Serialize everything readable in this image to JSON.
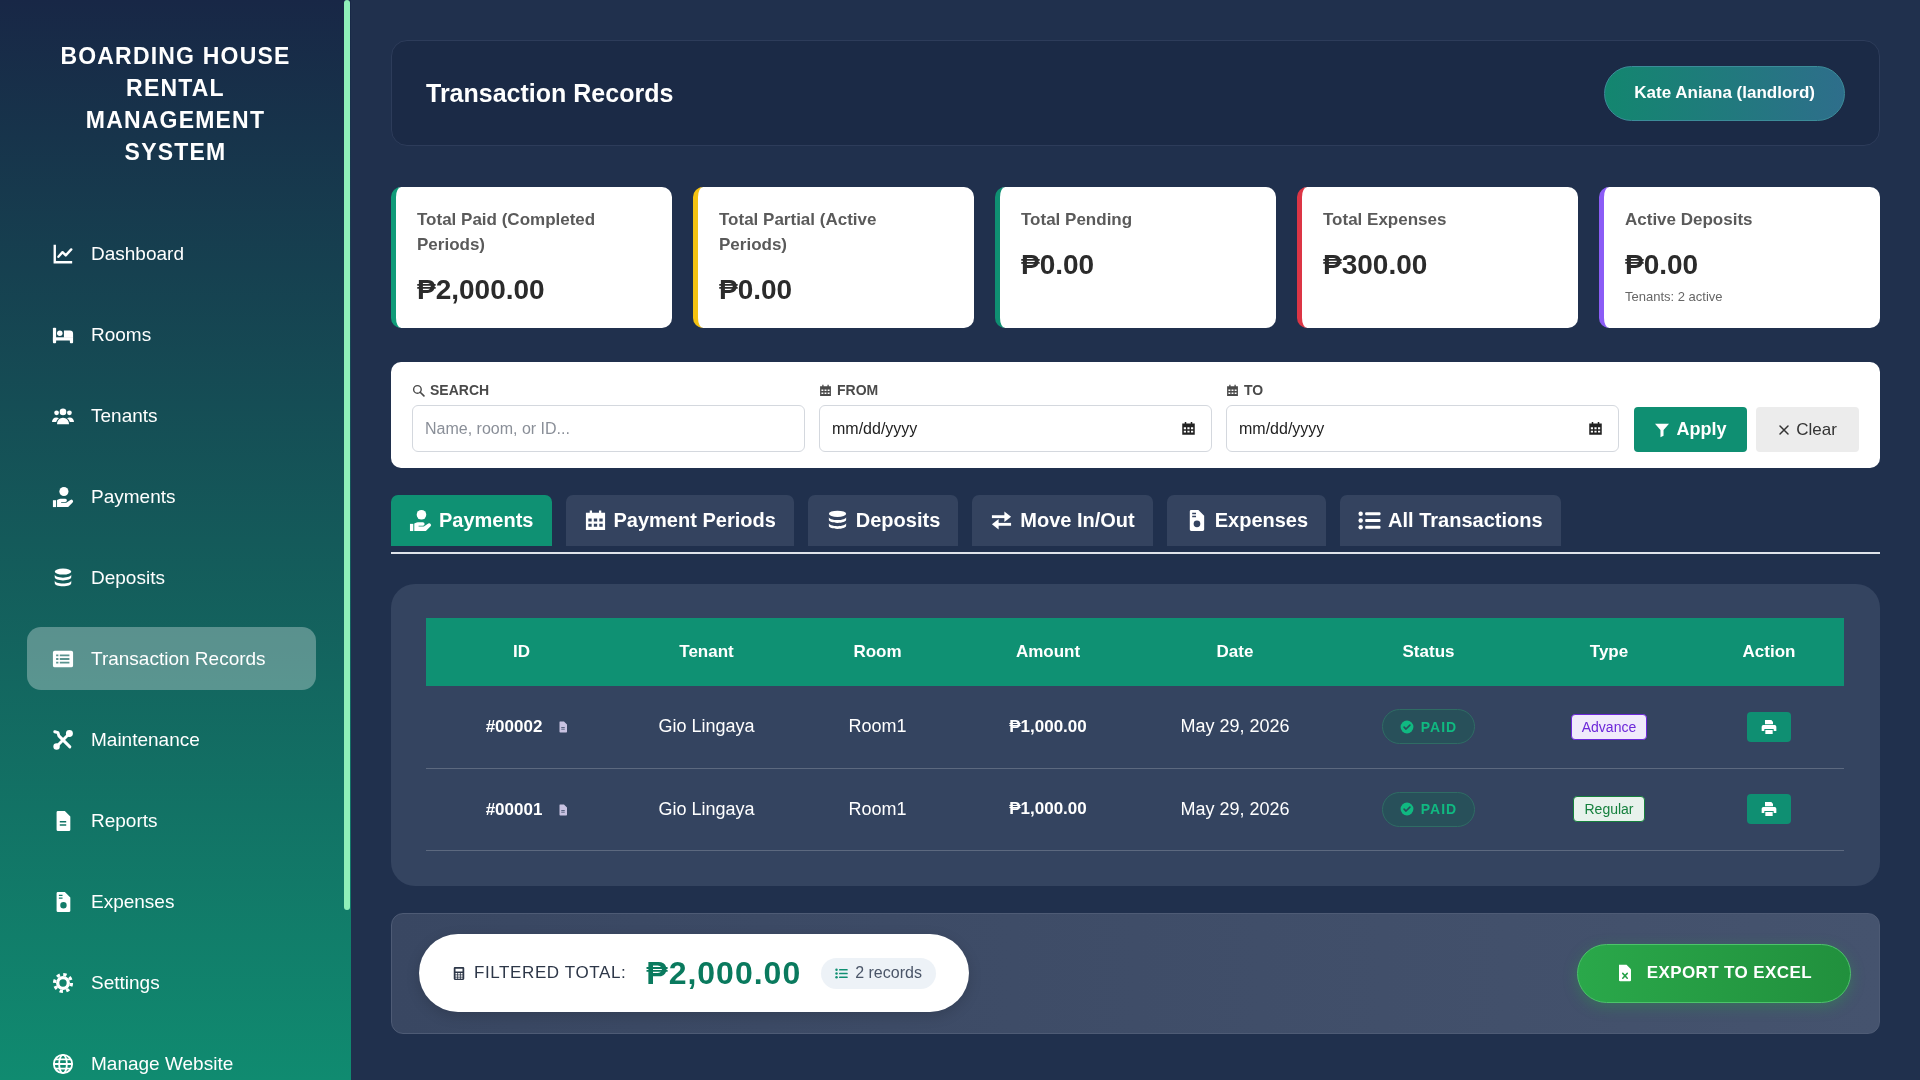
{
  "sidebar": {
    "title": "BOARDING HOUSE RENTAL MANAGEMENT SYSTEM",
    "items": [
      {
        "label": "Dashboard",
        "selected": false
      },
      {
        "label": "Rooms",
        "selected": false
      },
      {
        "label": "Tenants",
        "selected": false
      },
      {
        "label": "Payments",
        "selected": false
      },
      {
        "label": "Deposits",
        "selected": false
      },
      {
        "label": "Transaction Records",
        "selected": true
      },
      {
        "label": "Maintenance",
        "selected": false
      },
      {
        "label": "Reports",
        "selected": false
      },
      {
        "label": "Expenses",
        "selected": false
      },
      {
        "label": "Settings",
        "selected": false
      },
      {
        "label": "Manage Website",
        "selected": false
      }
    ]
  },
  "header": {
    "title": "Transaction Records",
    "user": "Kate Aniana (landlord)"
  },
  "stats": [
    {
      "label": "Total Paid (Completed Periods)",
      "value": "₱2,000.00",
      "color": "#0f9b78"
    },
    {
      "label": "Total Partial (Active Periods)",
      "value": "₱0.00",
      "color": "#f5c211"
    },
    {
      "label": "Total Pending",
      "value": "₱0.00",
      "color": "#0f8f72"
    },
    {
      "label": "Total Expenses",
      "value": "₱300.00",
      "color": "#dc3545"
    },
    {
      "label": "Active Deposits",
      "value": "₱0.00",
      "note": "Tenants: 2 active",
      "color": "#8b5cf6"
    }
  ],
  "filters": {
    "search": {
      "label": "SEARCH",
      "placeholder": "Name, room, or ID..."
    },
    "from": {
      "label": "FROM",
      "placeholder": "mm/dd/yyyy"
    },
    "to": {
      "label": "TO",
      "placeholder": "mm/dd/yyyy"
    },
    "buttons": [
      {
        "label": "Apply",
        "kind": "primary"
      },
      {
        "label": "Clear",
        "kind": "secondary"
      }
    ]
  },
  "tabs": [
    {
      "label": "Payments",
      "selected": true
    },
    {
      "label": "Payment Periods",
      "selected": false
    },
    {
      "label": "Deposits",
      "selected": false
    },
    {
      "label": "Move In/Out",
      "selected": false
    },
    {
      "label": "Expenses",
      "selected": false
    },
    {
      "label": "All Transactions",
      "selected": false
    }
  ],
  "table": {
    "columns": [
      "ID",
      "Tenant",
      "Room",
      "Amount",
      "Date",
      "Status",
      "Type",
      "Action"
    ],
    "rows": [
      {
        "id": "#00002",
        "tenant": "Gio Lingaya",
        "room": "Room1",
        "amount": "₱1,000.00",
        "date": "May 29, 2026",
        "status": "PAID",
        "type": {
          "label": "Advance",
          "color": "#6d28d9"
        }
      },
      {
        "id": "#00001",
        "tenant": "Gio Lingaya",
        "room": "Room1",
        "amount": "₱1,000.00",
        "date": "May 29, 2026",
        "status": "PAID",
        "type": {
          "label": "Regular",
          "color": "#15803d"
        }
      }
    ]
  },
  "footer": {
    "label": "FILTERED TOTAL:",
    "total": "₱2,000.00",
    "count": "2 records",
    "export": "EXPORT TO EXCEL"
  }
}
